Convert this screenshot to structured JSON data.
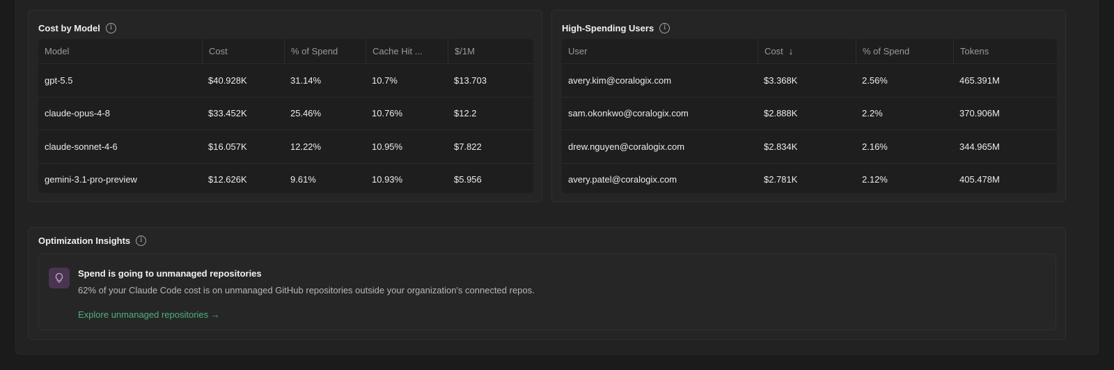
{
  "cost_by_model": {
    "title": "Cost by Model",
    "columns": [
      "Model",
      "Cost",
      "% of Spend",
      "Cache Hit ...",
      "$/1M"
    ],
    "rows": [
      [
        "gpt-5.5",
        "$40.928K",
        "31.14%",
        "10.7%",
        "$13.703"
      ],
      [
        "claude-opus-4-8",
        "$33.452K",
        "25.46%",
        "10.76%",
        "$12.2"
      ],
      [
        "claude-sonnet-4-6",
        "$16.057K",
        "12.22%",
        "10.95%",
        "$7.822"
      ],
      [
        "gemini-3.1-pro-preview",
        "$12.626K",
        "9.61%",
        "10.93%",
        "$5.956"
      ]
    ]
  },
  "high_spending_users": {
    "title": "High-Spending Users",
    "columns": [
      "User",
      "Cost",
      "% of Spend",
      "Tokens"
    ],
    "rows": [
      [
        "avery.kim@coralogix.com",
        "$3.368K",
        "2.56%",
        "465.391M"
      ],
      [
        "sam.okonkwo@coralogix.com",
        "$2.888K",
        "2.2%",
        "370.906M"
      ],
      [
        "drew.nguyen@coralogix.com",
        "$2.834K",
        "2.16%",
        "344.965M"
      ],
      [
        "avery.patel@coralogix.com",
        "$2.781K",
        "2.12%",
        "405.478M"
      ]
    ]
  },
  "optimization_insights": {
    "title": "Optimization Insights",
    "insight_title": "Spend is going to unmanaged repositories",
    "insight_desc": "62% of your Claude Code cost is on unmanaged GitHub repositories outside your organization's connected repos.",
    "insight_link": "Explore unmanaged repositories →"
  },
  "colors": {
    "background": "#1b1b1c",
    "panel": "#252526",
    "link": "#4fb276",
    "bulb_bg": "#4a3550"
  },
  "icons": [
    "info-icon",
    "sort-down-icon",
    "lightbulb-icon"
  ]
}
